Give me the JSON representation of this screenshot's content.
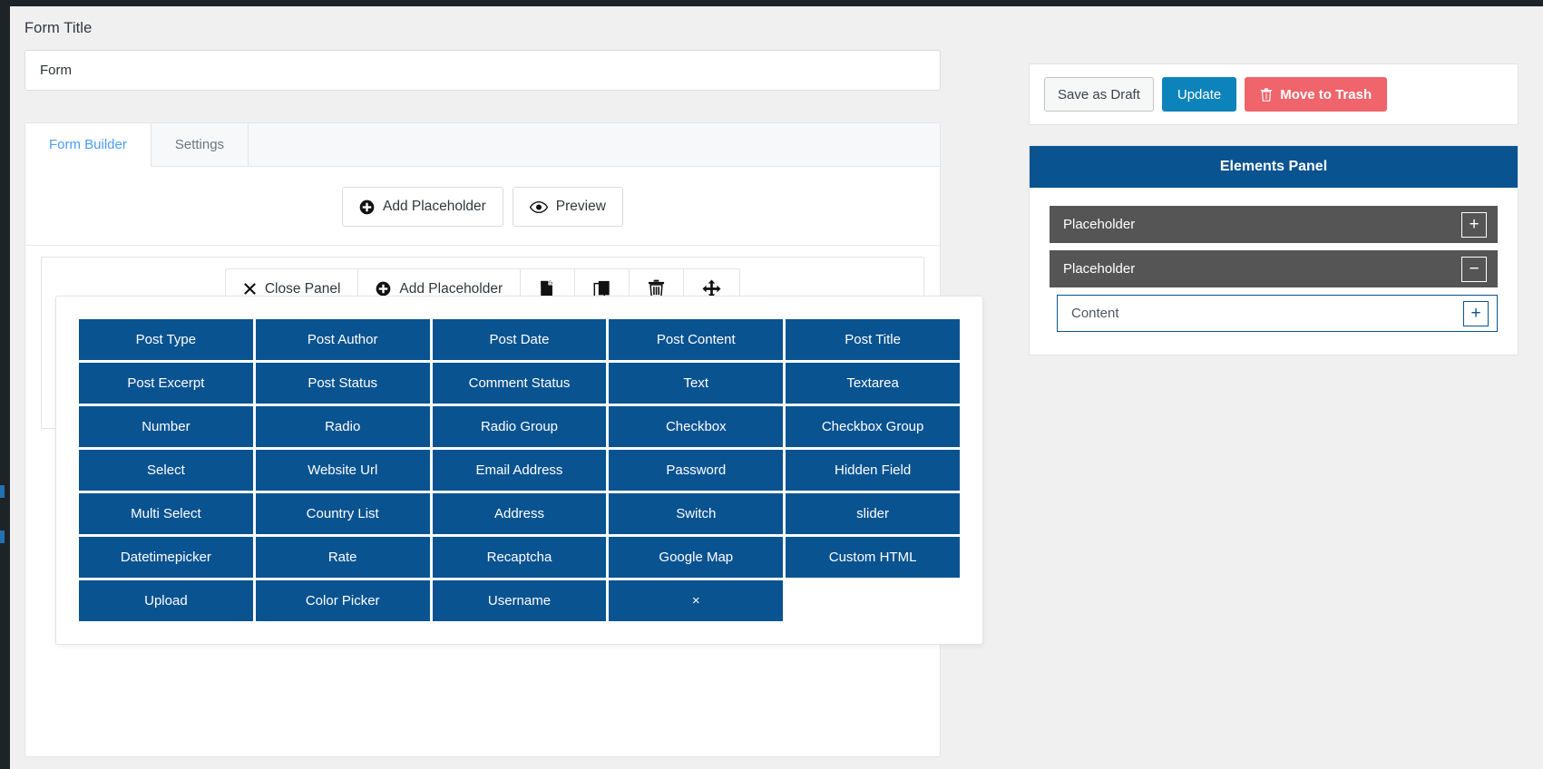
{
  "form_title": {
    "label": "Form Title",
    "value": "Form",
    "placeholder": "Form Title"
  },
  "tabs": [
    {
      "label": "Form Builder",
      "active": true
    },
    {
      "label": "Settings",
      "active": false
    }
  ],
  "top_actions": [
    {
      "label": "Add Placeholder",
      "icon": "plus-circle-icon"
    },
    {
      "label": "Preview",
      "icon": "eye-icon"
    }
  ],
  "panel_toolbar": [
    {
      "label": "Close Panel",
      "icon": "close-x-icon"
    },
    {
      "label": "Add Placeholder",
      "icon": "plus-circle-icon"
    },
    {
      "label": "",
      "icon": "new-page-icon"
    },
    {
      "label": "",
      "icon": "duplicate-icon"
    },
    {
      "label": "",
      "icon": "trash-icon"
    },
    {
      "label": "",
      "icon": "move-arrows-icon"
    }
  ],
  "field_types": [
    "Post Type",
    "Post Author",
    "Post Date",
    "Post Content",
    "Post Title",
    "Post Excerpt",
    "Post Status",
    "Comment Status",
    "Text",
    "Textarea",
    "Number",
    "Radio",
    "Radio Group",
    "Checkbox",
    "Checkbox Group",
    "Select",
    "Website Url",
    "Email Address",
    "Password",
    "Hidden Field",
    "Multi Select",
    "Country List",
    "Address",
    "Switch",
    "slider",
    "Datetimepicker",
    "Rate",
    "Recaptcha",
    "Google Map",
    "Custom HTML",
    "Upload",
    "Color Picker",
    "Username",
    "×"
  ],
  "publish": {
    "save_draft_label": "Save as Draft",
    "update_label": "Update",
    "trash_label": "Move to Trash",
    "trash_icon": "trash-icon"
  },
  "elements_panel": {
    "title": "Elements Panel",
    "rows": [
      {
        "label": "Placeholder",
        "button": "+",
        "button_name": "expand-button"
      },
      {
        "label": "Placeholder",
        "button": "−",
        "button_name": "collapse-button"
      }
    ],
    "content_row": {
      "label": "Content",
      "button": "+",
      "button_name": "add-content-button"
    }
  },
  "colors": {
    "brand_blue": "#0a5391",
    "update_blue": "#0d83bb",
    "trash_red": "#f0646b",
    "row_gray": "#555555",
    "tab_active": "#4a9df8",
    "page_bg": "#f0f0f1"
  }
}
